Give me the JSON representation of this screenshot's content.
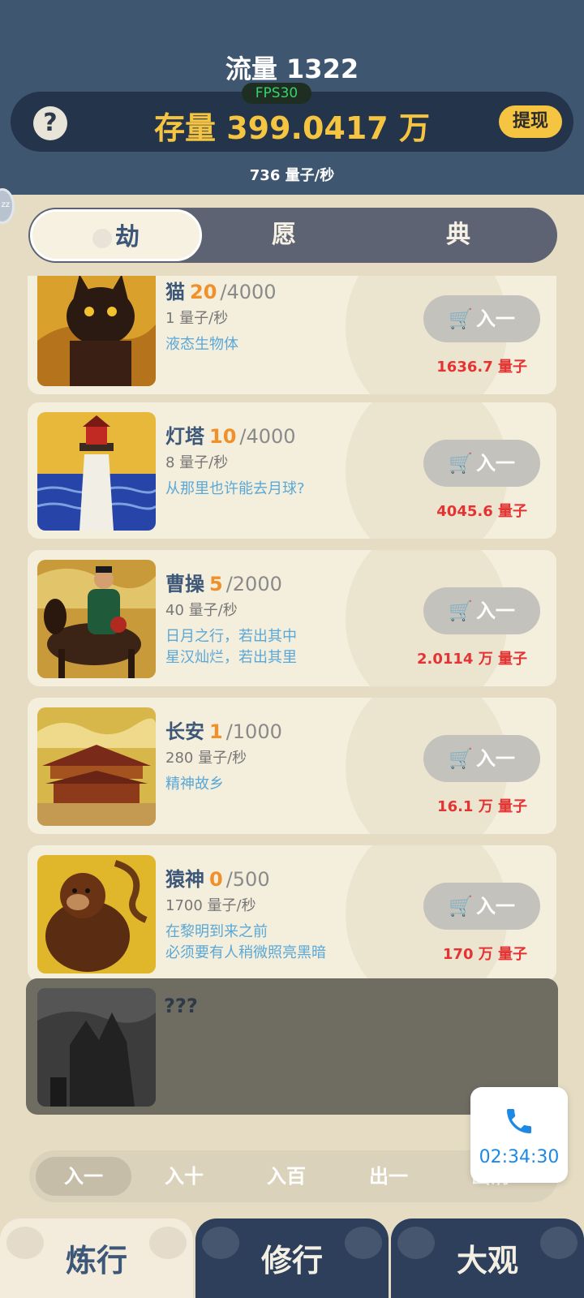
{
  "header": {
    "flow_label": "流量 1322",
    "fps": "FPS30",
    "help_symbol": "?",
    "stock_label": "存量 399.0417 万",
    "withdraw_label": "提现",
    "rate_label": "736  量子/秒",
    "side_bubble": "zz"
  },
  "tabs": [
    {
      "label": "劫",
      "active": true
    },
    {
      "label": "愿",
      "active": false
    },
    {
      "label": "典",
      "active": false
    }
  ],
  "items": [
    {
      "name": "猫",
      "count": "20",
      "max": "/4000",
      "rate": "1 量子/秒",
      "desc": [
        "液态生物体"
      ],
      "button": "入一",
      "price": "1636.7 量子"
    },
    {
      "name": "灯塔",
      "count": "10",
      "max": "/4000",
      "rate": "8 量子/秒",
      "desc": [
        "从那里也许能去月球?"
      ],
      "button": "入一",
      "price": "4045.6 量子"
    },
    {
      "name": "曹操",
      "count": "5",
      "max": "/2000",
      "rate": "40 量子/秒",
      "desc": [
        "日月之行，若出其中",
        "星汉灿烂，若出其里"
      ],
      "button": "入一",
      "price": "2.0114 万 量子"
    },
    {
      "name": "长安",
      "count": "1",
      "max": "/1000",
      "rate": "280 量子/秒",
      "desc": [
        "精神故乡"
      ],
      "button": "入一",
      "price": "16.1 万 量子"
    },
    {
      "name": "猿神",
      "count": "0",
      "max": "/500",
      "rate": "1700 量子/秒",
      "desc": [
        "在黎明到来之前",
        "必须要有人稍微照亮黑暗"
      ],
      "button": "入一",
      "price": "170 万 量子"
    }
  ],
  "locked_item": {
    "name": "???"
  },
  "quantity_options": [
    {
      "label": "入一",
      "active": true
    },
    {
      "label": "入十",
      "active": false
    },
    {
      "label": "入百",
      "active": false
    },
    {
      "label": "出一",
      "active": false
    },
    {
      "label": "出清",
      "active": false
    }
  ],
  "call_widget": {
    "time": "02:34:30",
    "icon": "phone-icon"
  },
  "bottom_nav": [
    {
      "label": "炼行",
      "active": true
    },
    {
      "label": "修行",
      "active": false
    },
    {
      "label": "大观",
      "active": false
    }
  ],
  "colors": {
    "header_bg": "#3f5670",
    "stock_gold": "#f5c542",
    "price_red": "#e53333",
    "desc_blue": "#5aa8d6",
    "count_orange": "#f0902a"
  }
}
